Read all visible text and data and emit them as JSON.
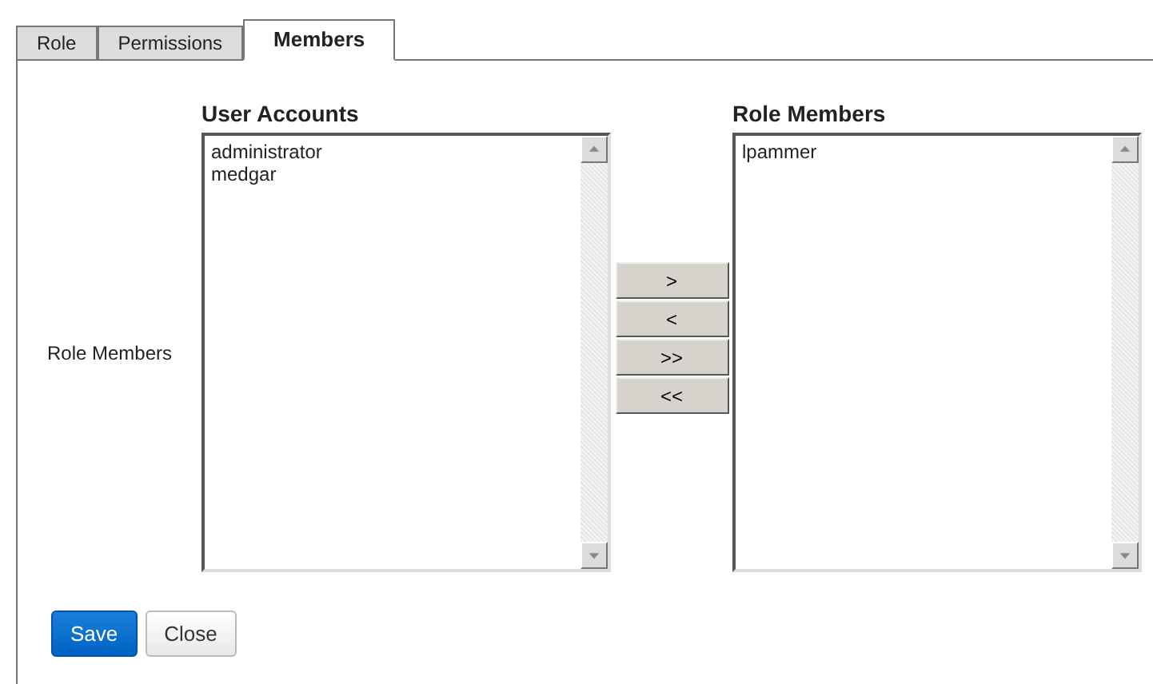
{
  "tabs": [
    {
      "label": "Role",
      "selected": false
    },
    {
      "label": "Permissions",
      "selected": false
    },
    {
      "label": "Members",
      "selected": true
    }
  ],
  "field_label": "Role Members",
  "available": {
    "title": "User Accounts",
    "items": [
      "administrator",
      "medgar"
    ]
  },
  "members": {
    "title": "Role Members",
    "items": [
      "lpammer"
    ]
  },
  "move_buttons": [
    ">",
    "<",
    ">>",
    "<<"
  ],
  "actions": [
    {
      "label": "Save",
      "kind": "primary"
    },
    {
      "label": "Close",
      "kind": "secondary"
    }
  ]
}
